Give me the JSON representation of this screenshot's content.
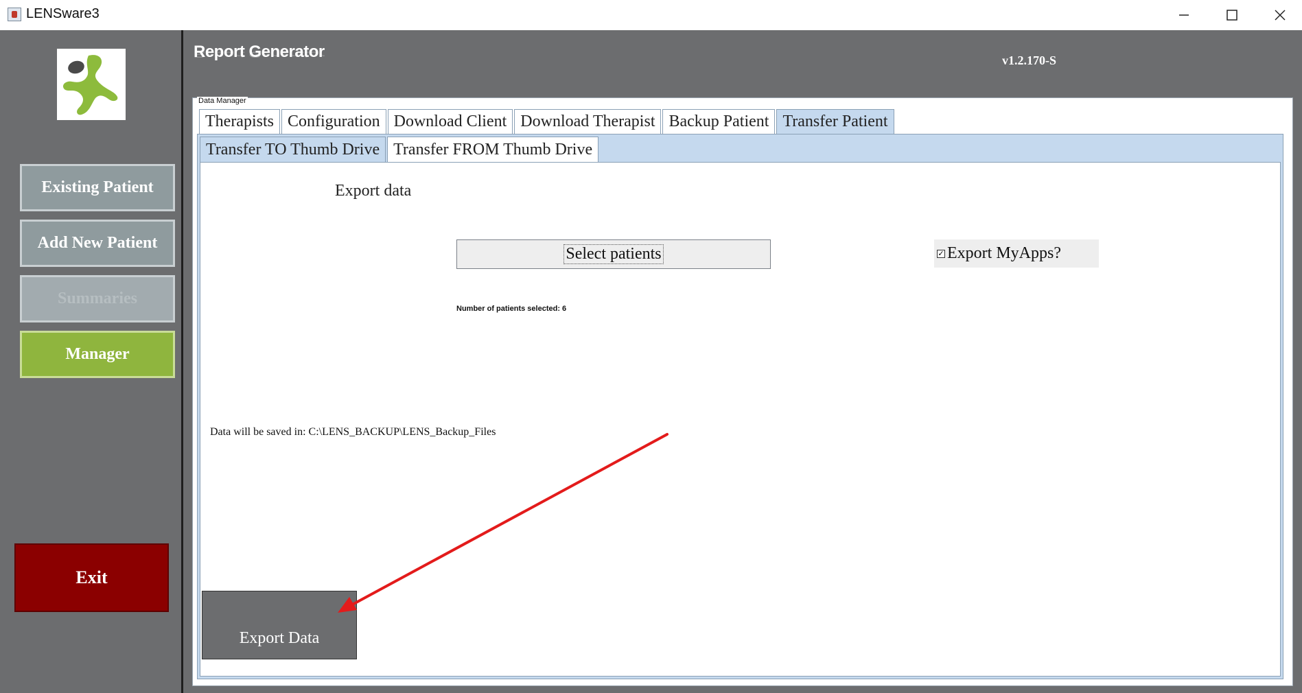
{
  "window": {
    "title": "LENSware3",
    "minimize_icon": "minimize-icon",
    "maximize_icon": "maximize-icon",
    "close_icon": "close-icon"
  },
  "header": {
    "title": "Report Generator",
    "version": "v1.2.170-S"
  },
  "sidebar": {
    "buttons": [
      {
        "label": "Existing Patient",
        "state": "normal"
      },
      {
        "label": "Add New Patient",
        "state": "normal"
      },
      {
        "label": "Summaries",
        "state": "disabled"
      },
      {
        "label": "Manager",
        "state": "active"
      }
    ],
    "exit_label": "Exit"
  },
  "panel": {
    "title": "Data Manager",
    "tabs": [
      "Therapists",
      "Configuration",
      "Download Client",
      "Download Therapist",
      "Backup Patient",
      "Transfer Patient"
    ],
    "selected_tab": "Transfer Patient",
    "subtabs": [
      "Transfer TO Thumb Drive",
      "Transfer FROM Thumb Drive"
    ],
    "selected_subtab": "Transfer TO Thumb Drive"
  },
  "content": {
    "heading": "Export data",
    "select_button": "Select patients",
    "export_myapps_label": "Export MyApps?",
    "export_myapps_checked": true,
    "patients_selected_text": "Number of patients selected:  6",
    "save_path_text": "Data will be saved in:  C:\\LENS_BACKUP\\LENS_Backup_Files",
    "export_button": "Export Data"
  },
  "colors": {
    "sidebar_bg": "#6c6d6f",
    "manager_active": "#8fb53e",
    "exit_bg": "#8b0000",
    "tab_selected": "#c5d9ee",
    "annotation_arrow": "#e31b1b"
  }
}
